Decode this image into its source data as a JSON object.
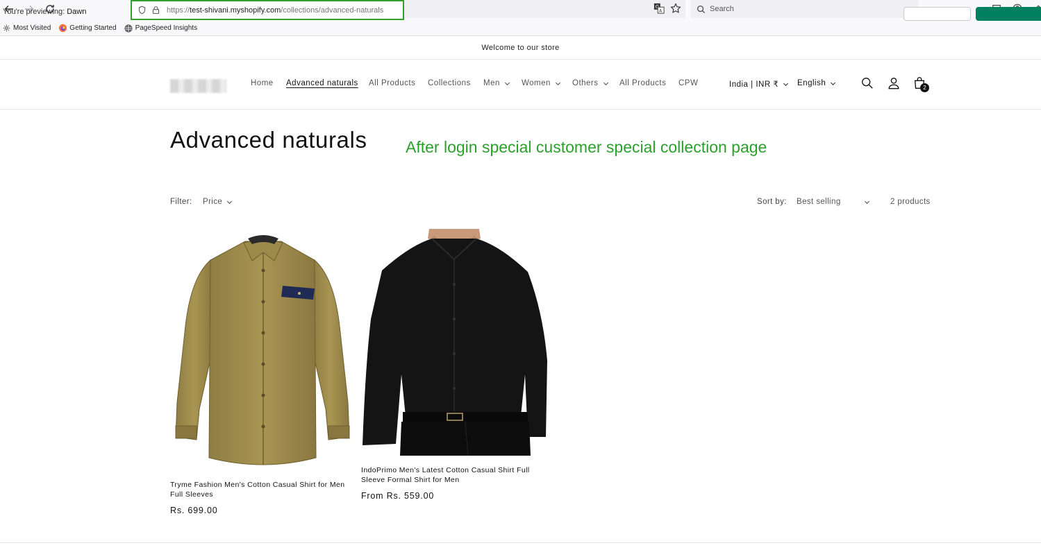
{
  "browser": {
    "url_prefix": "https://",
    "url_domain": "test-shivani.myshopify.com",
    "url_path": "/collections/advanced-naturals",
    "search_placeholder": "Search",
    "bookmarks": [
      "Most Visited",
      "Getting Started",
      "PageSpeed Insights"
    ]
  },
  "store": {
    "announcement": "Welcome to our store",
    "menu": [
      {
        "label": "Home"
      },
      {
        "label": "Advanced naturals",
        "active": true
      },
      {
        "label": "All Products"
      },
      {
        "label": "Collections"
      },
      {
        "label": "Men",
        "dropdown": true
      },
      {
        "label": "Women",
        "dropdown": true
      },
      {
        "label": "Others",
        "dropdown": true
      },
      {
        "label": "All Products"
      },
      {
        "label": "CPW"
      }
    ],
    "country_selector": "India | INR ₹",
    "language_selector": "English",
    "cart_count": "2"
  },
  "collection": {
    "title": "Advanced naturals",
    "annotation": "After login special customer special collection page",
    "filter_label": "Filter:",
    "filter_price": "Price",
    "sort_label": "Sort by:",
    "sort_value": "Best selling",
    "product_count": "2 products",
    "products": [
      {
        "title": "Tryme Fashion Men's Cotton Casual Shirt for Men Full Sleeves",
        "price": "Rs. 699.00",
        "image": "khaki-shirt"
      },
      {
        "title": "IndoPrimo Men's Latest Cotton Casual Shirt Full Sleeve Formal Shirt for Men",
        "price": "From Rs. 559.00",
        "image": "black-shirt"
      }
    ]
  },
  "preview": {
    "prefix": "You're previewing:",
    "theme": "Dawn"
  },
  "colors": {
    "annotation_green": "#2ca02c",
    "url_highlight": "#33a02c",
    "shopify_green": "#008060"
  }
}
